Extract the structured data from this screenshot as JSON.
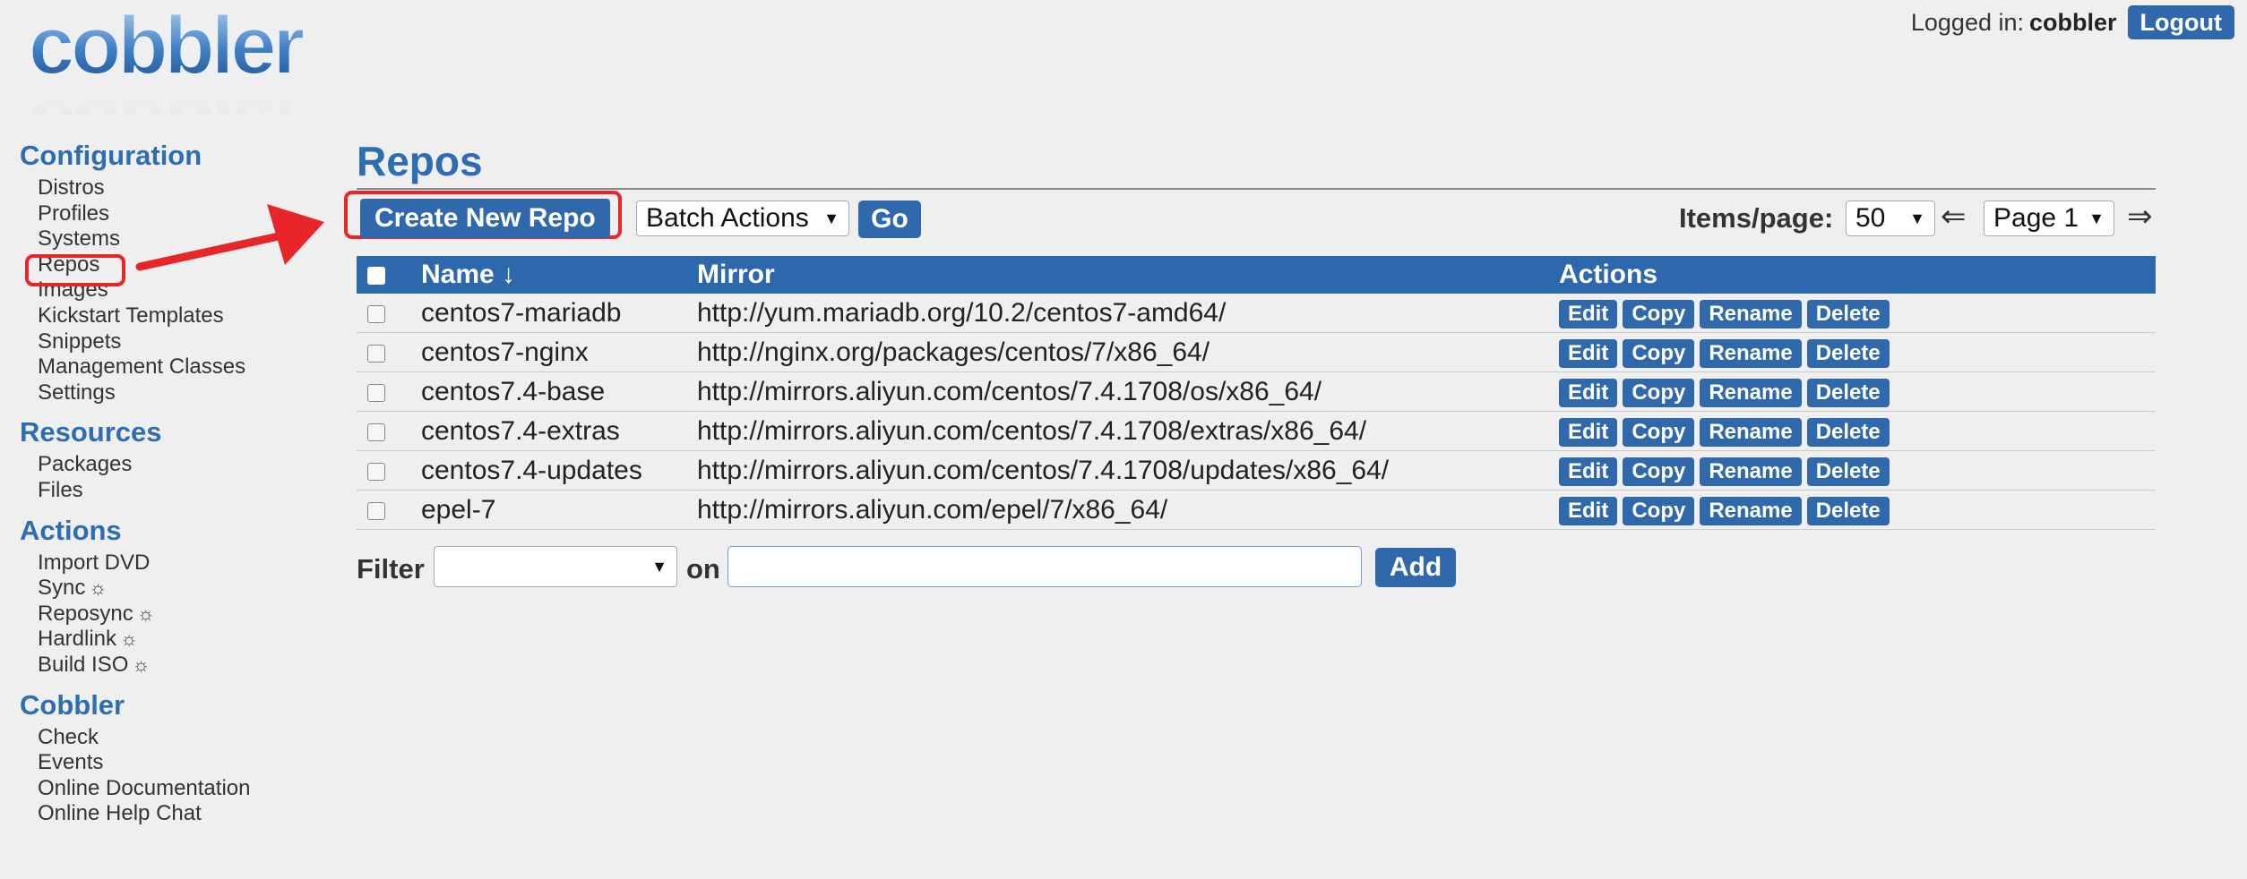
{
  "header": {
    "logo_text": "cobbler",
    "logged_in_label": "Logged in:",
    "username": "cobbler",
    "logout_label": "Logout"
  },
  "sidebar": {
    "sections": [
      {
        "title": "Configuration",
        "items": [
          "Distros",
          "Profiles",
          "Systems",
          "Repos",
          "Images",
          "Kickstart Templates",
          "Snippets",
          "Management Classes",
          "Settings"
        ]
      },
      {
        "title": "Resources",
        "items": [
          "Packages",
          "Files"
        ]
      },
      {
        "title": "Actions",
        "items": [
          "Import DVD",
          "Sync",
          "Reposync",
          "Hardlink",
          "Build ISO"
        ]
      },
      {
        "title": "Cobbler",
        "items": [
          "Check",
          "Events",
          "Online Documentation",
          "Online Help Chat"
        ]
      }
    ],
    "sun_glyph": "☼"
  },
  "main": {
    "title": "Repos",
    "create_button": "Create New Repo",
    "batch_actions": "Batch Actions",
    "go_label": "Go",
    "items_per_page_label": "Items/page:",
    "items_per_page_value": "50",
    "page_value": "Page 1",
    "prev_arrow": "⇐",
    "next_arrow": "⇒",
    "table": {
      "columns": [
        "Name ↓",
        "Mirror",
        "Actions"
      ],
      "rows": [
        {
          "name": "centos7-mariadb",
          "mirror": "http://yum.mariadb.org/10.2/centos7-amd64/"
        },
        {
          "name": "centos7-nginx",
          "mirror": "http://nginx.org/packages/centos/7/x86_64/"
        },
        {
          "name": "centos7.4-base",
          "mirror": "http://mirrors.aliyun.com/centos/7.4.1708/os/x86_64/"
        },
        {
          "name": "centos7.4-extras",
          "mirror": "http://mirrors.aliyun.com/centos/7.4.1708/extras/x86_64/"
        },
        {
          "name": "centos7.4-updates",
          "mirror": "http://mirrors.aliyun.com/centos/7.4.1708/updates/x86_64/"
        },
        {
          "name": "epel-7",
          "mirror": "http://mirrors.aliyun.com/epel/7/x86_64/"
        }
      ],
      "actions": [
        "Edit",
        "Copy",
        "Rename",
        "Delete"
      ]
    },
    "filter": {
      "label": "Filter",
      "on_label": "on",
      "add_label": "Add"
    }
  },
  "colors": {
    "accent": "#2f6db3",
    "header_bar": "#2d68ad",
    "annotation": "#e8262a"
  }
}
